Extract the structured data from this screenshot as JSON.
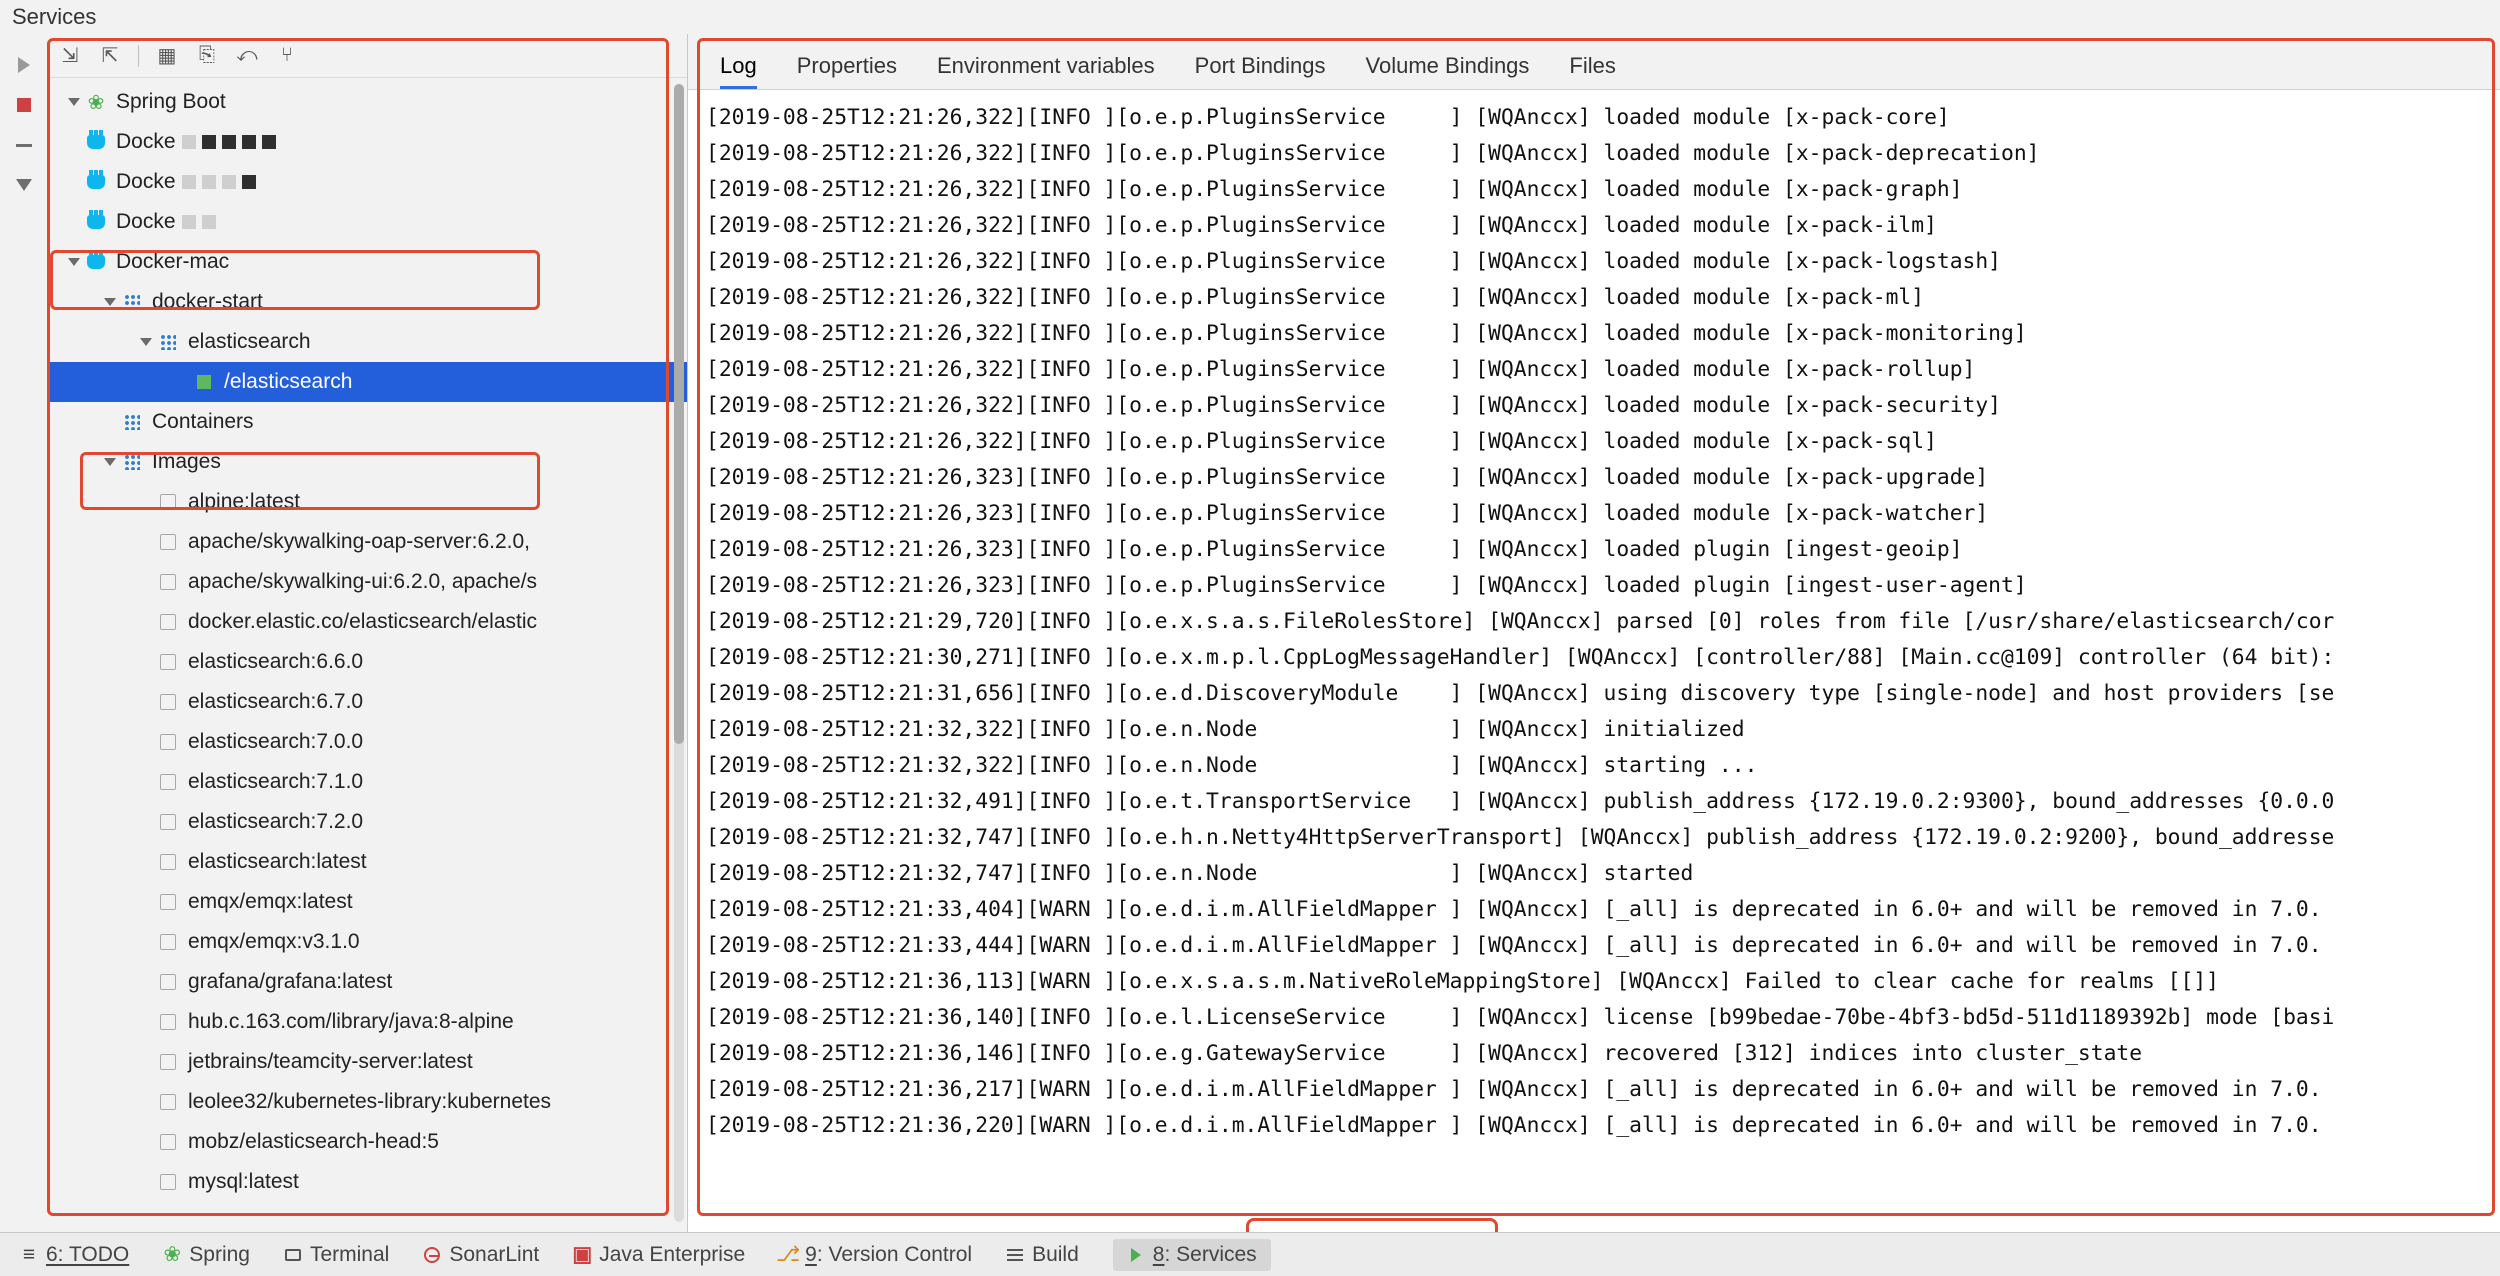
{
  "panel_title": "Services",
  "gutter": [
    "run",
    "stop",
    "minus",
    "filter"
  ],
  "tree_toolbar": [
    "expand-all",
    "collapse-all",
    "sep",
    "grid",
    "save-dashed",
    "import",
    "branch"
  ],
  "tree": [
    {
      "depth": 0,
      "arrow": "down",
      "icon": "spring",
      "label": "Spring Boot"
    },
    {
      "depth": 0,
      "arrow": "",
      "icon": "docker",
      "label": "Docke",
      "blurred": true,
      "blurs": [
        "lt",
        "dk",
        "",
        "dk",
        "dk"
      ]
    },
    {
      "depth": 0,
      "arrow": "",
      "icon": "docker",
      "label": "Docke",
      "blurred": true,
      "blurs": [
        "lt",
        "lt",
        "lt",
        "dk"
      ]
    },
    {
      "depth": 0,
      "arrow": "",
      "icon": "docker",
      "label": "Docke",
      "blurred": true,
      "blurs": [
        "lt",
        "lt"
      ]
    },
    {
      "depth": 0,
      "arrow": "down",
      "icon": "docker",
      "label": "Docker-mac"
    },
    {
      "depth": 1,
      "arrow": "down",
      "icon": "svc",
      "label": "docker-start"
    },
    {
      "depth": 2,
      "arrow": "down",
      "icon": "ctr",
      "label": "elasticsearch"
    },
    {
      "depth": 3,
      "arrow": "",
      "icon": "sq",
      "label": "/elasticsearch",
      "selected": true
    },
    {
      "depth": 1,
      "arrow": "",
      "icon": "dots",
      "label": "Containers"
    },
    {
      "depth": 1,
      "arrow": "down",
      "icon": "dots",
      "label": "Images"
    },
    {
      "depth": 2,
      "arrow": "",
      "icon": "box",
      "label": "alpine:latest"
    },
    {
      "depth": 2,
      "arrow": "",
      "icon": "box",
      "label": "apache/skywalking-oap-server:6.2.0,"
    },
    {
      "depth": 2,
      "arrow": "",
      "icon": "box",
      "label": "apache/skywalking-ui:6.2.0, apache/s"
    },
    {
      "depth": 2,
      "arrow": "",
      "icon": "box",
      "label": "docker.elastic.co/elasticsearch/elastic"
    },
    {
      "depth": 2,
      "arrow": "",
      "icon": "box",
      "label": "elasticsearch:6.6.0"
    },
    {
      "depth": 2,
      "arrow": "",
      "icon": "box",
      "label": "elasticsearch:6.7.0"
    },
    {
      "depth": 2,
      "arrow": "",
      "icon": "box",
      "label": "elasticsearch:7.0.0"
    },
    {
      "depth": 2,
      "arrow": "",
      "icon": "box",
      "label": "elasticsearch:7.1.0"
    },
    {
      "depth": 2,
      "arrow": "",
      "icon": "box",
      "label": "elasticsearch:7.2.0"
    },
    {
      "depth": 2,
      "arrow": "",
      "icon": "box",
      "label": "elasticsearch:latest"
    },
    {
      "depth": 2,
      "arrow": "",
      "icon": "box",
      "label": "emqx/emqx:latest"
    },
    {
      "depth": 2,
      "arrow": "",
      "icon": "box",
      "label": "emqx/emqx:v3.1.0"
    },
    {
      "depth": 2,
      "arrow": "",
      "icon": "box",
      "label": "grafana/grafana:latest"
    },
    {
      "depth": 2,
      "arrow": "",
      "icon": "box",
      "label": "hub.c.163.com/library/java:8-alpine"
    },
    {
      "depth": 2,
      "arrow": "",
      "icon": "box",
      "label": "jetbrains/teamcity-server:latest"
    },
    {
      "depth": 2,
      "arrow": "",
      "icon": "box",
      "label": "leolee32/kubernetes-library:kubernetes"
    },
    {
      "depth": 2,
      "arrow": "",
      "icon": "box",
      "label": "mobz/elasticsearch-head:5"
    },
    {
      "depth": 2,
      "arrow": "",
      "icon": "box",
      "label": "mysql:latest"
    }
  ],
  "tabs": [
    "Log",
    "Properties",
    "Environment variables",
    "Port Bindings",
    "Volume Bindings",
    "Files"
  ],
  "active_tab": 0,
  "log_lines": [
    "[2019-08-25T12:21:26,322][INFO ][o.e.p.PluginsService     ] [WQAnccx] loaded module [x-pack-core]",
    "[2019-08-25T12:21:26,322][INFO ][o.e.p.PluginsService     ] [WQAnccx] loaded module [x-pack-deprecation]",
    "[2019-08-25T12:21:26,322][INFO ][o.e.p.PluginsService     ] [WQAnccx] loaded module [x-pack-graph]",
    "[2019-08-25T12:21:26,322][INFO ][o.e.p.PluginsService     ] [WQAnccx] loaded module [x-pack-ilm]",
    "[2019-08-25T12:21:26,322][INFO ][o.e.p.PluginsService     ] [WQAnccx] loaded module [x-pack-logstash]",
    "[2019-08-25T12:21:26,322][INFO ][o.e.p.PluginsService     ] [WQAnccx] loaded module [x-pack-ml]",
    "[2019-08-25T12:21:26,322][INFO ][o.e.p.PluginsService     ] [WQAnccx] loaded module [x-pack-monitoring]",
    "[2019-08-25T12:21:26,322][INFO ][o.e.p.PluginsService     ] [WQAnccx] loaded module [x-pack-rollup]",
    "[2019-08-25T12:21:26,322][INFO ][o.e.p.PluginsService     ] [WQAnccx] loaded module [x-pack-security]",
    "[2019-08-25T12:21:26,322][INFO ][o.e.p.PluginsService     ] [WQAnccx] loaded module [x-pack-sql]",
    "[2019-08-25T12:21:26,323][INFO ][o.e.p.PluginsService     ] [WQAnccx] loaded module [x-pack-upgrade]",
    "[2019-08-25T12:21:26,323][INFO ][o.e.p.PluginsService     ] [WQAnccx] loaded module [x-pack-watcher]",
    "[2019-08-25T12:21:26,323][INFO ][o.e.p.PluginsService     ] [WQAnccx] loaded plugin [ingest-geoip]",
    "[2019-08-25T12:21:26,323][INFO ][o.e.p.PluginsService     ] [WQAnccx] loaded plugin [ingest-user-agent]",
    "[2019-08-25T12:21:29,720][INFO ][o.e.x.s.a.s.FileRolesStore] [WQAnccx] parsed [0] roles from file [/usr/share/elasticsearch/cor",
    "[2019-08-25T12:21:30,271][INFO ][o.e.x.m.p.l.CppLogMessageHandler] [WQAnccx] [controller/88] [Main.cc@109] controller (64 bit):",
    "[2019-08-25T12:21:31,656][INFO ][o.e.d.DiscoveryModule    ] [WQAnccx] using discovery type [single-node] and host providers [se",
    "[2019-08-25T12:21:32,322][INFO ][o.e.n.Node               ] [WQAnccx] initialized",
    "[2019-08-25T12:21:32,322][INFO ][o.e.n.Node               ] [WQAnccx] starting ...",
    "[2019-08-25T12:21:32,491][INFO ][o.e.t.TransportService   ] [WQAnccx] publish_address {172.19.0.2:9300}, bound_addresses {0.0.0",
    "[2019-08-25T12:21:32,747][INFO ][o.e.h.n.Netty4HttpServerTransport] [WQAnccx] publish_address {172.19.0.2:9200}, bound_addresse",
    "[2019-08-25T12:21:32,747][INFO ][o.e.n.Node               ] [WQAnccx] started",
    "[2019-08-25T12:21:33,404][WARN ][o.e.d.i.m.AllFieldMapper ] [WQAnccx] [_all] is deprecated in 6.0+ and will be removed in 7.0.",
    "[2019-08-25T12:21:33,444][WARN ][o.e.d.i.m.AllFieldMapper ] [WQAnccx] [_all] is deprecated in 6.0+ and will be removed in 7.0.",
    "[2019-08-25T12:21:36,113][WARN ][o.e.x.s.a.s.m.NativeRoleMappingStore] [WQAnccx] Failed to clear cache for realms [[]]",
    "[2019-08-25T12:21:36,140][INFO ][o.e.l.LicenseService     ] [WQAnccx] license [b99bedae-70be-4bf3-bd5d-511d1189392b] mode [basi",
    "[2019-08-25T12:21:36,146][INFO ][o.e.g.GatewayService     ] [WQAnccx] recovered [312] indices into cluster_state",
    "[2019-08-25T12:21:36,217][WARN ][o.e.d.i.m.AllFieldMapper ] [WQAnccx] [_all] is deprecated in 6.0+ and will be removed in 7.0.",
    "[2019-08-25T12:21:36,220][WARN ][o.e.d.i.m.AllFieldMapper ] [WQAnccx] [_all] is deprecated in 6.0+ and will be removed in 7.0."
  ],
  "bottom_bar": {
    "todo": "6: TODO",
    "spring": "Spring",
    "terminal": "Terminal",
    "sonarlint": "SonarLint",
    "jee": "Java Enterprise",
    "vcs": "9: Version Control",
    "build": "Build",
    "services": "8: Services"
  }
}
